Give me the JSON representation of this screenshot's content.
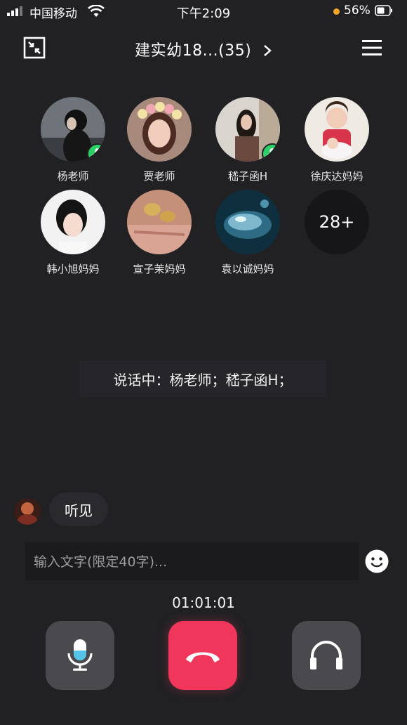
{
  "status_bar": {
    "carrier": "中国移动",
    "time": "下午2:09",
    "battery_percent": "56%"
  },
  "header": {
    "title": "建实幼18...(35)",
    "chevron": "chevron-right-icon"
  },
  "members": [
    {
      "name": "杨老师",
      "speaking": true
    },
    {
      "name": "贾老师",
      "speaking": false
    },
    {
      "name": "嵇子函H",
      "speaking": true
    },
    {
      "name": "徐庆达妈妈",
      "speaking": false
    },
    {
      "name": "韩小旭妈妈",
      "speaking": false
    },
    {
      "name": "宣子茉妈妈",
      "speaking": false
    },
    {
      "name": "袁以诚妈妈",
      "speaking": false
    }
  ],
  "more_count": "28+",
  "speaking_text": "说话中：杨老师；嵇子函H；",
  "chat": {
    "message": "听见"
  },
  "input": {
    "placeholder": "输入文字(限定40字)..."
  },
  "timer": "01:01:01",
  "colors": {
    "background": "#212124",
    "hangup": "#f0365a",
    "speaking_badge": "#2bd167",
    "control": "#4a4a4e"
  }
}
